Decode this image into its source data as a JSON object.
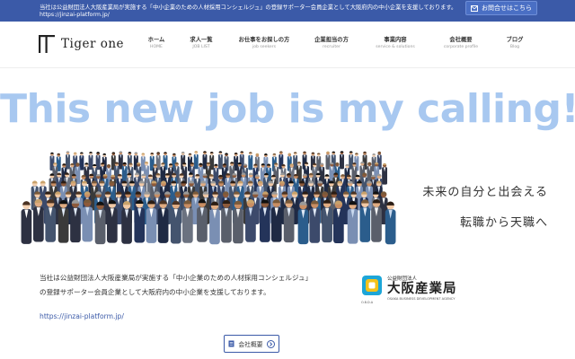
{
  "topbar": {
    "line1": "当社は公益財団法人大阪産業局が実施する「中小企業のための人材採用コンシェルジュ」の登録サポーター会員企業として大阪府内の中小企業を支援しております。",
    "line2": "https://jinzai-platform.jp/",
    "contact_label": "お問合せはこちら",
    "contact_icon": "envelope-icon"
  },
  "logo": {
    "text": "Tiger one"
  },
  "nav": [
    {
      "label": "ホーム",
      "sub": "HOME"
    },
    {
      "label": "求人一覧",
      "sub": "JOB LIST"
    },
    {
      "label": "お仕事をお探しの方",
      "sub": "job seekers"
    },
    {
      "label": "企業担当の方",
      "sub": "recruiter"
    },
    {
      "label": "事業内容",
      "sub": "service & solutions"
    },
    {
      "label": "会社概要",
      "sub": "corporate profile"
    },
    {
      "label": "ブログ",
      "sub": "Blog"
    }
  ],
  "hero": {
    "title": "This new job is my calling!",
    "tagline1": "未来の自分と出会える",
    "tagline2": "転職から天職へ"
  },
  "intro": {
    "text": "当社は公益財団法人大阪産業局が実施する「中小企業のための人材採用コンシェルジュ」の登録サポーター会員企業として大阪府内の中小企業を支援しております。",
    "link": "https://jinzai-platform.jp/"
  },
  "osaka": {
    "small": "公益財団法人",
    "big": "大阪産業局",
    "en": "OSAKA BUSINESS DEVELOPMENT AGENCY",
    "abbr": "O.B.D.A"
  },
  "about_button": {
    "label": "会社概要",
    "icon": "document-icon",
    "arrow": "arrow-right-circle-icon"
  }
}
